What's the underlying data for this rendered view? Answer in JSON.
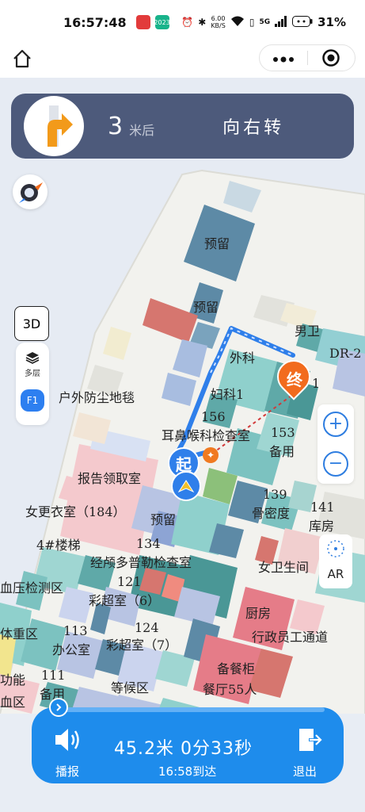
{
  "status_bar": {
    "time": "16:57:48",
    "app1": "",
    "app2": "2023",
    "net_speed_value": "6.00",
    "net_speed_unit": "KB/S",
    "signal": "5G",
    "battery": "31%"
  },
  "nav": {
    "home_icon": "home-icon",
    "more_icon": "more-dots-icon",
    "target_icon": "target-icon"
  },
  "guidance": {
    "distance": "3",
    "distance_unit": "米后",
    "instruction": "向右转"
  },
  "map_controls": {
    "mode_3d": "3D",
    "layers_label": "多层",
    "floor": "F1",
    "zoom_in": "+",
    "zoom_out": "−",
    "ar": "AR"
  },
  "markers": {
    "start": "起",
    "end": "终"
  },
  "map_labels": [
    "预留",
    "预留",
    "男卫",
    "DR-2",
    "外科",
    "妇科1",
    "1",
    "户外防尘地毯",
    "156",
    "耳鼻喉科检查室",
    "153",
    "备用",
    "报告领取室",
    "139",
    "骨密度",
    "141",
    "库房",
    "女更衣室（184）",
    "预留",
    "4#楼梯",
    "134",
    "经颅多普勒检查室",
    "女卫生间",
    "血压检测区",
    "121",
    "彩超室（6）",
    "厨房",
    "体重区",
    "113",
    "办公室",
    "124",
    "彩超室（7）",
    "行政员工通道",
    "备餐柜",
    "功能",
    "111",
    "备用",
    "等候区",
    "餐厅55人",
    "血区"
  ],
  "bottom_bar": {
    "broadcast": "播报",
    "distance_time": "45.2米  0分33秒",
    "eta": "16:58到达",
    "exit": "退出"
  },
  "colors": {
    "panel": "#4d5a7b",
    "route": "#2f7fea",
    "end_marker": "#f26b1d",
    "bottom_bar": "#1e8cec"
  }
}
